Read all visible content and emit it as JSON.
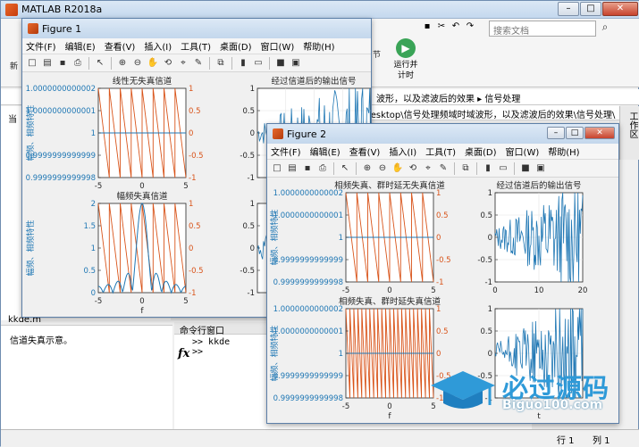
{
  "app": {
    "title": "MATLAB R2018a"
  },
  "ribbon": {
    "search_placeholder": "搜索文档",
    "run_label_1": "运行并",
    "run_label_2": "计时",
    "partial_new": "新",
    "partial_section": "节"
  },
  "address": {
    "path_tail": "波形，以及滤波后的效果 ▸ 信号处理",
    "path_full": "Desktop\\信号处理频域时域波形，以及滤波后的效果\\信号处理\\",
    "side_tab": "工作区"
  },
  "left_pane": {
    "label": "kkde.m",
    "details": "信道失真示意。",
    "current_folder": "当"
  },
  "command_window": {
    "header": "命令行窗口",
    "line1": ">> kkde",
    "line2": ">>",
    "fx": "fx"
  },
  "status": {
    "row": "行 1",
    "col": "列 1"
  },
  "figure_menu": [
    "文件(F)",
    "编辑(E)",
    "查看(V)",
    "插入(I)",
    "工具(T)",
    "桌面(D)",
    "窗口(W)",
    "帮助(H)"
  ],
  "figure1": {
    "title": "Figure 1",
    "sub1": {
      "title": "线性无失真信道",
      "ylabel": "幅频、相频特性",
      "xlabel": "",
      "yticks_left": [
        "1.0000000000002",
        "1.0000000000001",
        "1",
        "0.9999999999999",
        "0.9999999999998"
      ],
      "yticks_right": [
        "1",
        "0.5",
        "0",
        "-0.5",
        "-1"
      ],
      "xticks": [
        "-5",
        "0",
        "5"
      ]
    },
    "sub2": {
      "title": "经过信道后的输出信号",
      "yticks": [
        "1",
        "0.5",
        "0",
        "-0.5",
        "-1"
      ]
    },
    "sub3": {
      "title": "幅频失真信道",
      "ylabel": "幅频、相频特性",
      "xlabel": "f",
      "yticks_left": [
        "2",
        "1.5",
        "1",
        "0.5",
        "0"
      ],
      "yticks_right": [
        "1",
        "0.5",
        "0",
        "-0.5",
        "-1"
      ],
      "xticks": [
        "-5",
        "0",
        "5"
      ]
    },
    "sub4": {
      "yticks": [
        "1",
        "0.5",
        "0",
        "-0.5",
        "-1"
      ]
    }
  },
  "figure2": {
    "title": "Figure 2",
    "sub1": {
      "title": "相频失真、群时延无失真信道",
      "ylabel": "幅频、相频特性",
      "yticks_left": [
        "1.0000000000002",
        "1.0000000000001",
        "1",
        "0.9999999999999",
        "0.9999999999998"
      ],
      "yticks_right": [
        "1",
        "0.5",
        "0",
        "-0.5",
        "-1"
      ],
      "xticks": [
        "-5",
        "0",
        "5"
      ]
    },
    "sub2": {
      "title": "经过信道后的输出信号",
      "yticks": [
        "1",
        "0.5",
        "0",
        "-0.5",
        "-1"
      ],
      "xticks": [
        "0",
        "10",
        "20"
      ]
    },
    "sub3": {
      "title": "相频失真、群时延失真信道",
      "ylabel": "幅频、相频特性",
      "xlabel": "f",
      "yticks_left": [
        "1.0000000000002",
        "1.0000000000001",
        "1",
        "0.9999999999999",
        "0.9999999999998"
      ],
      "yticks_right": [
        "1",
        "0.5",
        "0",
        "-0.5",
        "-1"
      ],
      "xticks": [
        "-5",
        "0",
        "5"
      ]
    },
    "sub4": {
      "yticks": [
        "1",
        "0.5",
        "0",
        "-0.5",
        "-1"
      ],
      "xlabel": "t"
    }
  },
  "watermark": {
    "text": "必过源码",
    "sub": "Biguo100.com"
  },
  "colors": {
    "blue": "#1f77b4",
    "orange": "#d9541a",
    "accent": "#0072bd"
  }
}
